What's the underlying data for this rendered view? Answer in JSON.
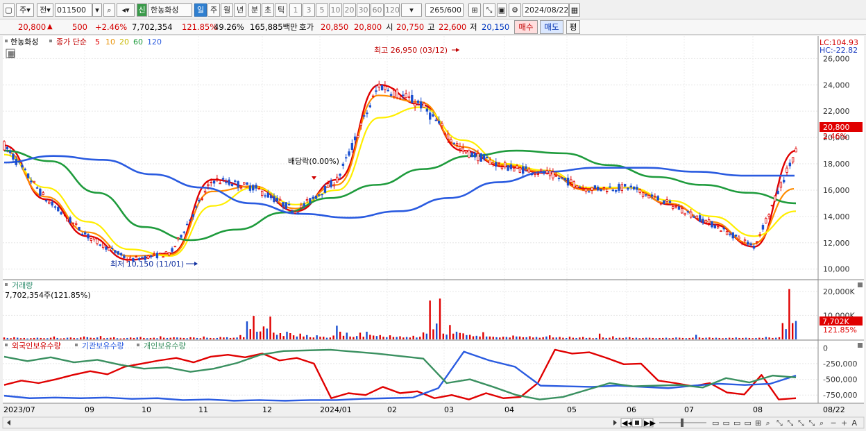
{
  "toolbar": {
    "market_type": "주",
    "prev_label": "전",
    "stock_code": "011500",
    "sin_badge": "신",
    "stock_name": "한농화성",
    "periods": [
      "일",
      "주",
      "월",
      "년",
      "분",
      "초",
      "틱"
    ],
    "active_period": "일",
    "intervals": [
      "1",
      "3",
      "5",
      "10",
      "20",
      "30",
      "60",
      "120"
    ],
    "count": "265",
    "count_max": "/600",
    "date": "2024/08/22"
  },
  "quote": {
    "price": "20,800",
    "change": "500",
    "change_pct": "+2.46%",
    "volume": "7,702,354",
    "volume_ratio": "121.85%",
    "turnover": "49.26%",
    "amount": "165,885백만",
    "ask_label": "호가",
    "ask": "20,850",
    "bid": "20,800",
    "open_label": "시",
    "open": "20,750",
    "high_label": "고",
    "high": "22,600",
    "low_label": "저",
    "low": "20,150",
    "buy_label": "매수",
    "sell_label": "매도",
    "eval_label": "평"
  },
  "price_panel": {
    "name": "한농화성",
    "ma_title": "종가 단순",
    "ma_periods": [
      "5",
      "10",
      "20",
      "60",
      "120"
    ],
    "lc": "LC:104.93",
    "hc": "HC:-22.82",
    "current_price_label": "20,800",
    "current_pct_label": "2.46%",
    "high_annotation": "최고 26,950 (03/12)",
    "low_annotation": "최저 10,150 (11/01)",
    "dividend_annotation": "배당락(0.00%)"
  },
  "volume_panel": {
    "title": "거래량",
    "value_label": "7,702,354주(121.85%)",
    "current_label": "7,702K",
    "current_pct": "121.85%"
  },
  "holdings_panel": {
    "legend": [
      "외국인보유수량",
      "기관보유수량",
      "개인보유수량"
    ]
  },
  "x_axis": {
    "labels": [
      "2023/07",
      "09",
      "10",
      "11",
      "12",
      "2024/01",
      "02",
      "03",
      "04",
      "05",
      "06",
      "07",
      "08",
      "08/22"
    ]
  },
  "chart_data": [
    {
      "type": "line",
      "title": "",
      "y_ticks": [
        10000,
        12000,
        14000,
        16000,
        18000,
        20000,
        22000,
        24000,
        26000
      ],
      "ylim": [
        9300,
        27600
      ],
      "x": [
        "2023/07",
        "09",
        "10",
        "11",
        "12",
        "2024/01",
        "02",
        "03",
        "04",
        "05",
        "06",
        "07",
        "08"
      ],
      "series": [
        {
          "name": "5",
          "color": "#e00000",
          "values": [
            19400,
            15300,
            12500,
            10700,
            11200,
            16800,
            16200,
            14400,
            16800,
            24000,
            22500,
            19000,
            17800,
            17300,
            16100,
            16200,
            14900,
            13400,
            11700,
            19000
          ]
        },
        {
          "name": "10",
          "color": "#ff8c00",
          "values": [
            19000,
            15500,
            12800,
            11000,
            11100,
            15900,
            16300,
            14600,
            16400,
            23200,
            22700,
            19300,
            17900,
            17400,
            16000,
            16200,
            15000,
            13600,
            11900,
            16100
          ]
        },
        {
          "name": "20",
          "color": "#ffee00",
          "values": [
            18700,
            16200,
            13600,
            11500,
            11000,
            14800,
            16200,
            14900,
            16000,
            21500,
            22300,
            19800,
            18000,
            17500,
            16200,
            16200,
            15200,
            14000,
            12500,
            14400
          ]
        },
        {
          "name": "60",
          "color": "#1e9b3c",
          "values": [
            19000,
            18200,
            15800,
            13200,
            12200,
            13000,
            14300,
            15400,
            16400,
            17600,
            18600,
            19000,
            18800,
            17900,
            17000,
            16400,
            15800,
            15000
          ]
        },
        {
          "name": "120",
          "color": "#2a5be0",
          "values": [
            18100,
            18600,
            18300,
            17200,
            16200,
            15000,
            14200,
            13900,
            14400,
            15400,
            16600,
            17400,
            17700,
            17700,
            17400,
            17100,
            17100
          ]
        }
      ]
    },
    {
      "type": "bar",
      "title": "거래량",
      "y_ticks": [
        10000,
        20000
      ],
      "ylim": [
        0,
        24000
      ],
      "values_k": [
        800,
        600,
        500,
        900,
        700,
        500,
        600,
        400,
        500,
        600,
        700,
        600,
        500,
        500,
        700,
        1200,
        600,
        400,
        500,
        700,
        800,
        600,
        500,
        800,
        1200,
        900,
        700,
        600,
        800,
        1400,
        500,
        600,
        700,
        900,
        500,
        400,
        500,
        600,
        800,
        600,
        800,
        1000,
        600,
        500,
        600,
        700,
        500,
        1300,
        700,
        600,
        700,
        900,
        800,
        700,
        600,
        500,
        900,
        800,
        600,
        500,
        1200,
        700,
        600,
        500,
        600,
        1000,
        800,
        900,
        600,
        700,
        800,
        1800,
        900,
        7500,
        4300,
        9800,
        3200,
        3300,
        5400,
        4500,
        9500,
        2800,
        1900,
        2600,
        1400,
        3200,
        2600,
        1700,
        1200,
        2400,
        1200,
        1800,
        900,
        800,
        1700,
        1100,
        1100,
        700,
        800,
        1600,
        5700,
        3200,
        1500,
        2800,
        1200,
        1000,
        1400,
        2800,
        1100,
        3200,
        1900,
        1600,
        1400,
        1800,
        1100,
        900,
        1700,
        1000,
        1000,
        1300,
        800,
        1000,
        800,
        1500,
        800,
        1100,
        2900,
        2400,
        16200,
        4200,
        6600,
        17000,
        2400,
        2000,
        6000,
        2400,
        3200,
        2700,
        2500,
        1800,
        1900,
        1300,
        1500,
        1200,
        3000,
        1200,
        1200,
        1100,
        900,
        800,
        1100,
        1000,
        800,
        1600,
        1200,
        1200,
        900,
        900,
        1300,
        800,
        1000,
        700,
        900,
        1200,
        1700,
        800,
        800,
        1000,
        700,
        600,
        1100,
        700,
        600,
        800,
        1000,
        600,
        700,
        500,
        600,
        2400,
        800,
        600,
        700,
        1300,
        600,
        700,
        600,
        800,
        900,
        600,
        700,
        500,
        600,
        700,
        700,
        600,
        500,
        600,
        600,
        700,
        500,
        600,
        800,
        700,
        600,
        500,
        600,
        700,
        1900,
        800,
        600,
        700,
        800,
        600,
        700,
        600,
        500,
        600,
        700,
        600,
        800,
        600,
        600,
        700,
        600,
        500,
        600,
        700,
        600,
        1000,
        800,
        600,
        700,
        900,
        6800,
        4300,
        21000,
        6800,
        7700
      ]
    },
    {
      "type": "line",
      "title": "",
      "y_ticks": [
        0,
        -250000,
        -500000,
        -750000
      ],
      "ylim": [
        -880000,
        80000
      ],
      "series": [
        {
          "name": "외국인보유수량",
          "color": "#e00000",
          "values": [
            -590000,
            -520000,
            -560000,
            -500000,
            -430000,
            -370000,
            -420000,
            -300000,
            -250000,
            -200000,
            -160000,
            -230000,
            -140000,
            -110000,
            -150000,
            -90000,
            -200000,
            -160000,
            -250000,
            -800000,
            -720000,
            -750000,
            -620000,
            -720000,
            -690000,
            -800000,
            -750000,
            -820000,
            -720000,
            -800000,
            -780000,
            -560000,
            -30000,
            -90000,
            -70000,
            -160000,
            -260000,
            -250000,
            -520000,
            -560000,
            -610000,
            -560000,
            -710000,
            -740000,
            -430000,
            -820000,
            -800000
          ]
        },
        {
          "name": "기관보유수량",
          "color": "#2a5be0",
          "values": [
            -760000,
            -800000,
            -790000,
            -800000,
            -790000,
            -810000,
            -800000,
            -830000,
            -820000,
            -840000,
            -830000,
            -840000,
            -830000,
            -830000,
            -810000,
            -800000,
            -790000,
            -640000,
            -60000,
            -200000,
            -300000,
            -600000,
            -610000,
            -620000,
            -600000,
            -620000,
            -640000,
            -600000,
            -570000,
            -590000,
            -570000,
            -440000
          ]
        },
        {
          "name": "개인보유수량",
          "color": "#3a9060",
          "values": [
            -140000,
            -210000,
            -150000,
            -230000,
            -190000,
            -270000,
            -330000,
            -310000,
            -380000,
            -330000,
            -240000,
            -110000,
            -50000,
            -40000,
            -30000,
            -60000,
            -90000,
            -130000,
            -170000,
            -560000,
            -500000,
            -620000,
            -750000,
            -820000,
            -780000,
            -670000,
            -560000,
            -610000,
            -600000,
            -590000,
            -630000,
            -480000,
            -550000,
            -440000,
            -470000
          ]
        }
      ]
    }
  ]
}
